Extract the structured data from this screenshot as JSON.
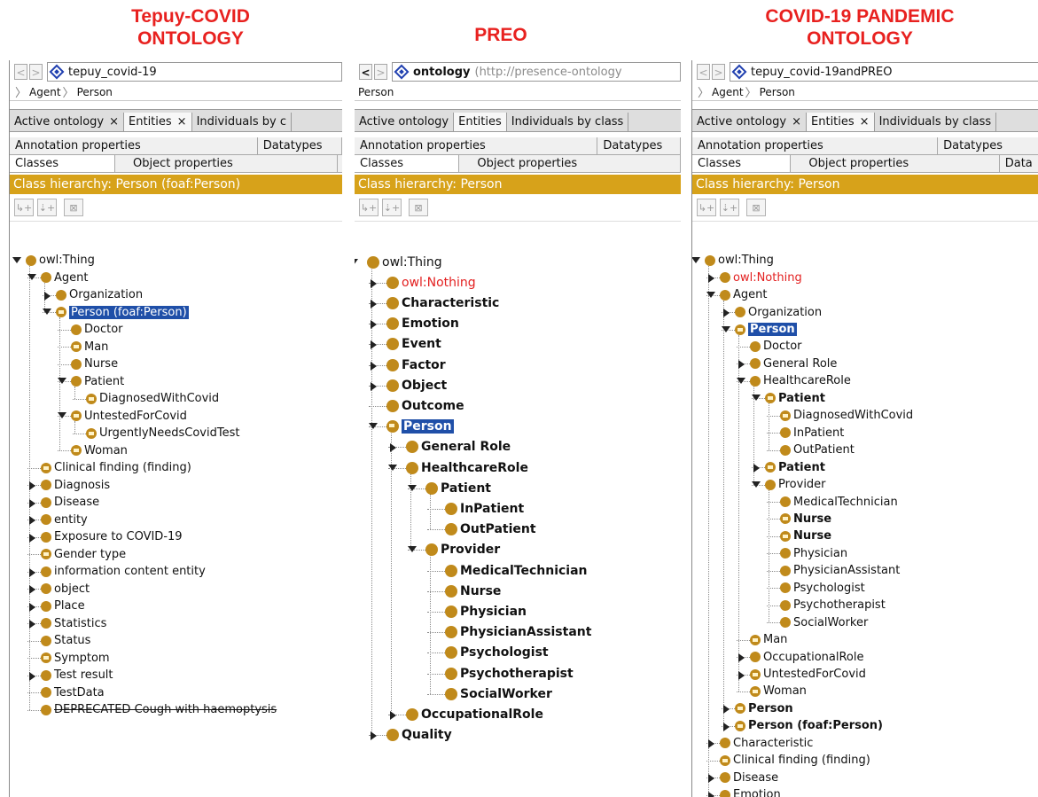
{
  "captions": {
    "left": [
      "Tepuy-COVID",
      "ONTOLOGY"
    ],
    "middle": [
      "PREO"
    ],
    "right": [
      "COVID-19 PANDEMIC",
      "ONTOLOGY"
    ]
  },
  "accent_color": "#d7a21a",
  "title_color": "#e8211f",
  "panels": [
    {
      "ontology_label": "tepuy_covid-19",
      "breadcrumb": [
        "Agent",
        "Person"
      ],
      "tabs": [
        "Active ontology",
        "Entities",
        "Individuals by c"
      ],
      "subtabs_row1": [
        "Annotation properties",
        "Datatypes"
      ],
      "subtabs_row2": [
        "Classes",
        "Object properties"
      ],
      "hierarchy_title": "Class hierarchy: Person (foaf:Person)",
      "tree": [
        "owl:Thing",
        "Agent",
        "Organization",
        "Person (foaf:Person)",
        "Doctor",
        "Man",
        "Nurse",
        "Patient",
        "DiagnosedWithCovid",
        "UntestedForCovid",
        "UrgentlyNeedsCovidTest",
        "Woman",
        "Clinical finding (finding)",
        "Diagnosis",
        "Disease",
        "entity",
        "Exposure to COVID-19",
        "Gender type",
        "information content entity",
        "object",
        "Place",
        "Statistics",
        "Status",
        "Symptom",
        "Test result",
        "TestData",
        "DEPRECATED Cough with haemoptysis"
      ]
    },
    {
      "ontology_label": "ontology",
      "ontology_iri": "(http://presence-ontology",
      "breadcrumb": [
        "Person"
      ],
      "tabs": [
        "Active ontology",
        "Entities",
        "Individuals by class"
      ],
      "subtabs_row1": [
        "Annotation properties",
        "Datatypes"
      ],
      "subtabs_row2": [
        "Classes",
        "Object properties"
      ],
      "hierarchy_title": "Class hierarchy: Person",
      "tree": [
        "owl:Thing",
        "owl:Nothing",
        "Characteristic",
        "Emotion",
        "Event",
        "Factor",
        "Object",
        "Outcome",
        "Person",
        "General Role",
        "HealthcareRole",
        "Patient",
        "InPatient",
        "OutPatient",
        "Provider",
        "MedicalTechnician",
        "Nurse",
        "Physician",
        "PhysicianAssistant",
        "Psychologist",
        "Psychotherapist",
        "SocialWorker",
        "OccupationalRole",
        "Quality"
      ]
    },
    {
      "ontology_label": "tepuy_covid-19andPREO",
      "breadcrumb": [
        "Agent",
        "Person"
      ],
      "tabs": [
        "Active ontology",
        "Entities",
        "Individuals by class"
      ],
      "subtabs_row1": [
        "Annotation properties",
        "Datatypes"
      ],
      "subtabs_row2": [
        "Classes",
        "Object properties",
        "Data"
      ],
      "hierarchy_title": "Class hierarchy: Person",
      "tree": [
        "owl:Thing",
        "owl:Nothing",
        "Agent",
        "Organization",
        "Person",
        "Doctor",
        "General Role",
        "HealthcareRole",
        "Patient",
        "DiagnosedWithCovid",
        "InPatient",
        "OutPatient",
        "Patient",
        "Provider",
        "MedicalTechnician",
        "Nurse",
        "Nurse",
        "Physician",
        "PhysicianAssistant",
        "Psychologist",
        "Psychotherapist",
        "SocialWorker",
        "Man",
        "OccupationalRole",
        "UntestedForCovid",
        "Woman",
        "Person",
        "Person (foaf:Person)",
        "Characteristic",
        "Clinical finding (finding)",
        "Disease",
        "Emotion"
      ]
    }
  ]
}
